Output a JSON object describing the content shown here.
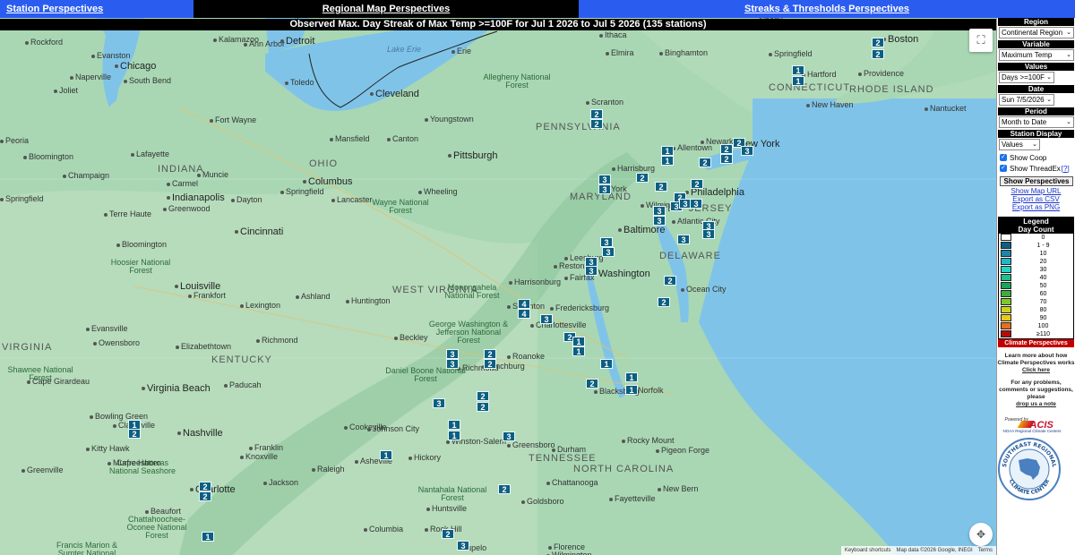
{
  "nav": {
    "station": "Station Perspectives",
    "regional": "Regional Map Perspectives",
    "streaks": "Streaks & Thresholds Perspectives"
  },
  "map_title": "Observed Max. Day Streak of Max Temp >=100F for Jul 1 2026 to Jul 5 2026 (135 stations)",
  "map_colors": {
    "land": "#a9d7b4",
    "water": "#7fc4e8",
    "marker": "#0d5f80"
  },
  "cities": [
    {
      "n": "Rockford",
      "t": "city"
    },
    {
      "n": "Evanston",
      "t": "city"
    },
    {
      "n": "Chicago",
      "t": "big"
    },
    {
      "n": "Naperville",
      "t": "city"
    },
    {
      "n": "Joliet",
      "t": "city"
    },
    {
      "n": "South Bend",
      "t": "city"
    },
    {
      "n": "Kalamazoo",
      "t": "city"
    },
    {
      "n": "Ann Arbor",
      "t": "city"
    },
    {
      "n": "Detroit",
      "t": "big"
    },
    {
      "n": "Toledo",
      "t": "city"
    },
    {
      "n": "Lansing",
      "t": "city"
    },
    {
      "n": "Cleveland",
      "t": "big"
    },
    {
      "n": "Erie",
      "t": "city"
    },
    {
      "n": "Lake Erie",
      "t": "water"
    },
    {
      "n": "Elmira",
      "t": "city"
    },
    {
      "n": "Binghamton",
      "t": "city"
    },
    {
      "n": "Ithaca",
      "t": "city"
    },
    {
      "n": "Albany",
      "t": "city"
    },
    {
      "n": "MASSACHUSETTS",
      "t": "state"
    },
    {
      "n": "Boston",
      "t": "big"
    },
    {
      "n": "Springfield",
      "t": "city"
    },
    {
      "n": "Hartford",
      "t": "city"
    },
    {
      "n": "Providence",
      "t": "city"
    },
    {
      "n": "CONNECTICUT",
      "t": "state"
    },
    {
      "n": "RHODE ISLAND",
      "t": "state"
    },
    {
      "n": "New Haven",
      "t": "city"
    },
    {
      "n": "Nantucket",
      "t": "city"
    },
    {
      "n": "Scranton",
      "t": "city"
    },
    {
      "n": "Youngstown",
      "t": "city"
    },
    {
      "n": "Allegheny National Forest",
      "t": "park"
    },
    {
      "n": "PENNSYLVANIA",
      "t": "state"
    },
    {
      "n": "Fort Wayne",
      "t": "city"
    },
    {
      "n": "Mansfield",
      "t": "city"
    },
    {
      "n": "Canton",
      "t": "city"
    },
    {
      "n": "Peoria",
      "t": "city"
    },
    {
      "n": "Bloomington",
      "t": "city"
    },
    {
      "n": "Lafayette",
      "t": "city"
    },
    {
      "n": "INDIANA",
      "t": "state"
    },
    {
      "n": "Muncie",
      "t": "city"
    },
    {
      "n": "OHIO",
      "t": "state"
    },
    {
      "n": "Columbus",
      "t": "big"
    },
    {
      "n": "Pittsburgh",
      "t": "big"
    },
    {
      "n": "Wheeling",
      "t": "city"
    },
    {
      "n": "Allentown",
      "t": "city"
    },
    {
      "n": "Newark",
      "t": "city"
    },
    {
      "n": "New York",
      "t": "big"
    },
    {
      "n": "Champaign",
      "t": "city"
    },
    {
      "n": "Carmel",
      "t": "city"
    },
    {
      "n": "Indianapolis",
      "t": "big"
    },
    {
      "n": "Dayton",
      "t": "city"
    },
    {
      "n": "Springfield",
      "t": "city"
    },
    {
      "n": "Lancaster",
      "t": "city"
    },
    {
      "n": "Harrisburg",
      "t": "city"
    },
    {
      "n": "York",
      "t": "city"
    },
    {
      "n": "Philadelphia",
      "t": "big"
    },
    {
      "n": "Wilmington",
      "t": "city"
    },
    {
      "n": "Springfield",
      "t": "city"
    },
    {
      "n": "Greenwood",
      "t": "city"
    },
    {
      "n": "Terre Haute",
      "t": "city"
    },
    {
      "n": "Cincinnati",
      "t": "big"
    },
    {
      "n": "Wayne National Forest",
      "t": "park"
    },
    {
      "n": "MARYLAND",
      "t": "state"
    },
    {
      "n": "Baltimore",
      "t": "big"
    },
    {
      "n": "NEW JERSEY",
      "t": "state"
    },
    {
      "n": "Atlantic City",
      "t": "city"
    },
    {
      "n": "Bloomington",
      "t": "city"
    },
    {
      "n": "Hoosier National Forest",
      "t": "park"
    },
    {
      "n": "Louisville",
      "t": "big"
    },
    {
      "n": "Frankfort",
      "t": "city"
    },
    {
      "n": "Lexington",
      "t": "city"
    },
    {
      "n": "Ashland",
      "t": "city"
    },
    {
      "n": "Huntington",
      "t": "city"
    },
    {
      "n": "WEST VIRGINIA",
      "t": "state"
    },
    {
      "n": "Monongahela National Forest",
      "t": "park"
    },
    {
      "n": "Leesburg",
      "t": "city"
    },
    {
      "n": "Washington",
      "t": "big"
    },
    {
      "n": "Reston",
      "t": "city"
    },
    {
      "n": "Fairfax",
      "t": "city"
    },
    {
      "n": "DELAWARE",
      "t": "state"
    },
    {
      "n": "Ocean City",
      "t": "city"
    },
    {
      "n": "Harrisonburg",
      "t": "city"
    },
    {
      "n": "Staunton",
      "t": "city"
    },
    {
      "n": "Fredericksburg",
      "t": "city"
    },
    {
      "n": "Charlottesville",
      "t": "city"
    },
    {
      "n": "Evansville",
      "t": "city"
    },
    {
      "n": "Owensboro",
      "t": "city"
    },
    {
      "n": "Richmond",
      "t": "city"
    },
    {
      "n": "Elizabethtown",
      "t": "city"
    },
    {
      "n": "Beckley",
      "t": "city"
    },
    {
      "n": "George Washington & Jefferson National Forest",
      "t": "park"
    },
    {
      "n": "Richmond",
      "t": "city"
    },
    {
      "n": "KENTUCKY",
      "t": "state"
    },
    {
      "n": "Lynchburg",
      "t": "city"
    },
    {
      "n": "Roanoke",
      "t": "city"
    },
    {
      "n": "VIRGINIA",
      "t": "state"
    },
    {
      "n": "Shawnee National Forest",
      "t": "park"
    },
    {
      "n": "Cape Girardeau",
      "t": "city"
    },
    {
      "n": "Paducah",
      "t": "city"
    },
    {
      "n": "Daniel Boone National Forest",
      "t": "park"
    },
    {
      "n": "Blacksburg",
      "t": "city"
    },
    {
      "n": "Norfolk",
      "t": "city"
    },
    {
      "n": "Virginia Beach",
      "t": "big"
    },
    {
      "n": "Bowling Green",
      "t": "city"
    },
    {
      "n": "Clarksville",
      "t": "city"
    },
    {
      "n": "Nashville",
      "t": "big"
    },
    {
      "n": "Cookeville",
      "t": "city"
    },
    {
      "n": "Johnson City",
      "t": "city"
    },
    {
      "n": "Winston-Salem",
      "t": "city"
    },
    {
      "n": "Greensboro",
      "t": "city"
    },
    {
      "n": "Durham",
      "t": "city"
    },
    {
      "n": "Rocky Mount",
      "t": "city"
    },
    {
      "n": "Kitty Hawk",
      "t": "city"
    },
    {
      "n": "Franklin",
      "t": "city"
    },
    {
      "n": "Knoxville",
      "t": "city"
    },
    {
      "n": "Pigeon Forge",
      "t": "city"
    },
    {
      "n": "Cape Hatteras National Seashore",
      "t": "park"
    },
    {
      "n": "Murfreesboro",
      "t": "city"
    },
    {
      "n": "TENNESSEE",
      "t": "state"
    },
    {
      "n": "Raleigh",
      "t": "city"
    },
    {
      "n": "Asheville",
      "t": "city"
    },
    {
      "n": "Hickory",
      "t": "city"
    },
    {
      "n": "NORTH CAROLINA",
      "t": "state"
    },
    {
      "n": "Greenville",
      "t": "city"
    },
    {
      "n": "Jackson",
      "t": "city"
    },
    {
      "n": "Nantahala National Forest",
      "t": "park"
    },
    {
      "n": "Charlotte",
      "t": "big"
    },
    {
      "n": "Chattanooga",
      "t": "city"
    },
    {
      "n": "Goldsboro",
      "t": "city"
    },
    {
      "n": "Fayetteville",
      "t": "city"
    },
    {
      "n": "New Bern",
      "t": "city"
    },
    {
      "n": "Beaufort",
      "t": "city"
    },
    {
      "n": "Chattahoochee-Oconee National Forest",
      "t": "park"
    },
    {
      "n": "Huntsville",
      "t": "city"
    },
    {
      "n": "Rock Hill",
      "t": "city"
    },
    {
      "n": "Columbia",
      "t": "city"
    },
    {
      "n": "Francis Marion & Sumter National Forests",
      "t": "park"
    },
    {
      "n": "Tupelo",
      "t": "city"
    },
    {
      "n": "Florence",
      "t": "city"
    },
    {
      "n": "Wilmington",
      "t": "city"
    },
    {
      "n": "Greenville",
      "t": "city"
    }
  ],
  "markers": [
    {
      "v": "2"
    },
    {
      "v": "2"
    },
    {
      "v": "1"
    },
    {
      "v": "1"
    },
    {
      "v": "2"
    },
    {
      "v": "2"
    },
    {
      "v": "1"
    },
    {
      "v": "1"
    },
    {
      "v": "2"
    },
    {
      "v": "2"
    },
    {
      "v": "2"
    },
    {
      "v": "2"
    },
    {
      "v": "3"
    },
    {
      "v": "2"
    },
    {
      "v": "3"
    },
    {
      "v": "3"
    },
    {
      "v": "2"
    },
    {
      "v": "2"
    },
    {
      "v": "2"
    },
    {
      "v": "3"
    },
    {
      "v": "3"
    },
    {
      "v": "3"
    },
    {
      "v": "3"
    },
    {
      "v": "3"
    },
    {
      "v": "3"
    },
    {
      "v": "3"
    },
    {
      "v": "3"
    },
    {
      "v": "3"
    },
    {
      "v": "3"
    },
    {
      "v": "3"
    },
    {
      "v": "3"
    },
    {
      "v": "2"
    },
    {
      "v": "2"
    },
    {
      "v": "4"
    },
    {
      "v": "4"
    },
    {
      "v": "3"
    },
    {
      "v": "2"
    },
    {
      "v": "1"
    },
    {
      "v": "1"
    },
    {
      "v": "3"
    },
    {
      "v": "2"
    },
    {
      "v": "3"
    },
    {
      "v": "2"
    },
    {
      "v": "1"
    },
    {
      "v": "2"
    },
    {
      "v": "1"
    },
    {
      "v": "1"
    },
    {
      "v": "3"
    },
    {
      "v": "2"
    },
    {
      "v": "2"
    },
    {
      "v": "1"
    },
    {
      "v": "1"
    },
    {
      "v": "3"
    },
    {
      "v": "2"
    },
    {
      "v": "2"
    },
    {
      "v": "1"
    },
    {
      "v": "2"
    },
    {
      "v": "2"
    },
    {
      "v": "3"
    },
    {
      "v": "1"
    },
    {
      "v": "2"
    },
    {
      "v": "1"
    }
  ],
  "panel": {
    "region_h": "Region",
    "region_v": "Continental Region",
    "variable_h": "Variable",
    "variable_v": "Maximum Temp",
    "values_h": "Values",
    "values_v": "Days >=100F",
    "date_h": "Date",
    "date_v": "Sun 7/5/2026",
    "period_h": "Period",
    "period_v": "Month to Date",
    "display_h": "Station Display",
    "display_v": "Values",
    "coop": "Show Coop",
    "threadex": "Show ThreadEx",
    "threadex_q": "[?]",
    "show_btn": "Show Perspectives",
    "link_url": "Show Map URL",
    "link_csv": "Export as CSV",
    "link_png": "Export as PNG",
    "legend_h": "Legend",
    "legend_sub": "Day Count",
    "cp": "Climate Perspectives",
    "learn1": "Learn more about how Climate Perspectives works",
    "learn_link": "Click here",
    "contact1": "For any problems, comments or suggestions, please",
    "contact_link": "drop us a note",
    "powered": "Powered by",
    "acis": "ACIS",
    "acis_sub": "NOAA Regional Climate Centers",
    "seal_top": "SOUTHEAST REGIONAL",
    "seal_bottom": "CLIMATE CENTER"
  },
  "legend": [
    {
      "label": "0",
      "color": "#ffffff"
    },
    {
      "label": "1 - 9",
      "color": "#0d5f80"
    },
    {
      "label": "10",
      "color": "#1a86a8"
    },
    {
      "label": "20",
      "color": "#20b8cc"
    },
    {
      "label": "30",
      "color": "#20d6c4"
    },
    {
      "label": "40",
      "color": "#1fc08a"
    },
    {
      "label": "50",
      "color": "#19a65a"
    },
    {
      "label": "60",
      "color": "#3cae3c"
    },
    {
      "label": "70",
      "color": "#7cc92a"
    },
    {
      "label": "80",
      "color": "#c8d41a"
    },
    {
      "label": "90",
      "color": "#e8c818"
    },
    {
      "label": "100",
      "color": "#e87018"
    },
    {
      "label": "≥110",
      "color": "#b80a0a"
    }
  ],
  "attribution": [
    "Keyboard shortcuts",
    "Map data ©2026 Google, INEGI",
    "Terms"
  ],
  "icons": {
    "fullscreen": "fullscreen-icon",
    "camera": "camera-control-icon"
  }
}
